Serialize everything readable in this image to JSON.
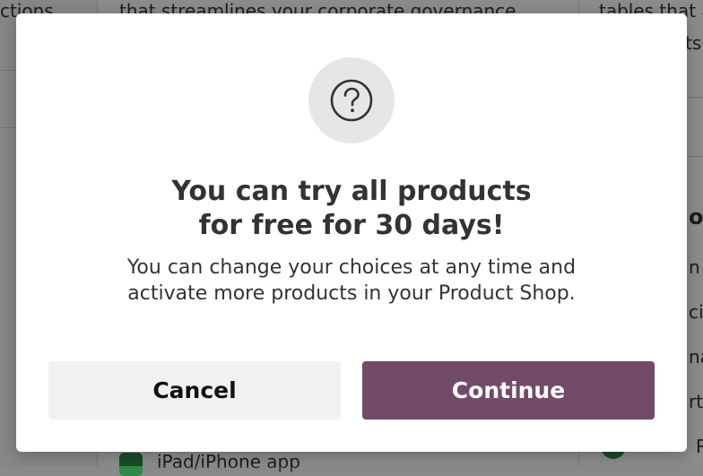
{
  "background": {
    "left_text_1": "ctions",
    "middle_text_1": "that streamlines your corporate governance",
    "right_text_1": "tables that a",
    "right_text_2": "ts",
    "right_text_3": "o",
    "right_text_4": "n",
    "right_text_5": "ci",
    "right_text_6": "na",
    "right_text_7": "rt",
    "right_text_8": "R",
    "middle_text_bottom": "iPad/iPhone app"
  },
  "modal": {
    "icon": "question-circle-icon",
    "title_line1": "You can try all products",
    "title_line2": "for free for 30 days!",
    "subtitle_line1": "You can change your choices at any time and",
    "subtitle_line2": "activate more products in your Product Shop.",
    "cancel_label": "Cancel",
    "continue_label": "Continue"
  },
  "colors": {
    "primary": "#714b67",
    "icon_bg": "#e6e6e6",
    "cancel_bg": "#f1f1f1",
    "check_green": "#2f8a4a"
  }
}
